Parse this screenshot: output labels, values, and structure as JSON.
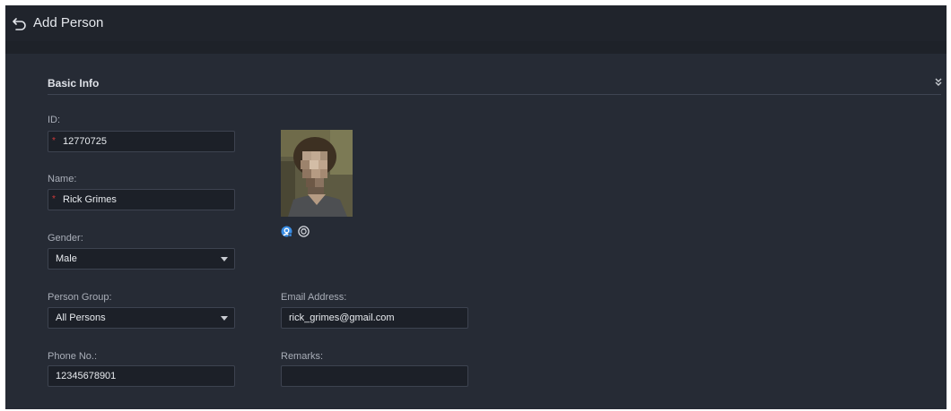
{
  "header": {
    "title": "Add Person",
    "back_icon": "back-arrow-icon"
  },
  "section": {
    "title": "Basic Info",
    "collapse_icon": "double-chevron-down-icon"
  },
  "form": {
    "id": {
      "label": "ID:",
      "value": "12770725",
      "required_mark": "*"
    },
    "name": {
      "label": "Name:",
      "value": "Rick Grimes",
      "required_mark": "*"
    },
    "gender": {
      "label": "Gender:",
      "value": "Male"
    },
    "person_group": {
      "label": "Person Group:",
      "value": "All Persons"
    },
    "phone": {
      "label": "Phone No.:",
      "value": "12345678901"
    },
    "email": {
      "label": "Email Address:",
      "value": "rick_grimes@gmail.com"
    },
    "remarks": {
      "label": "Remarks:",
      "value": ""
    }
  },
  "photo": {
    "upload_icon": "camera-upload-icon",
    "capture_icon": "face-capture-icon"
  },
  "colors": {
    "background": "#262b35",
    "header": "#20242c",
    "field": "#1c2028",
    "required": "#d23a3a",
    "accent": "#3a8ee6"
  }
}
